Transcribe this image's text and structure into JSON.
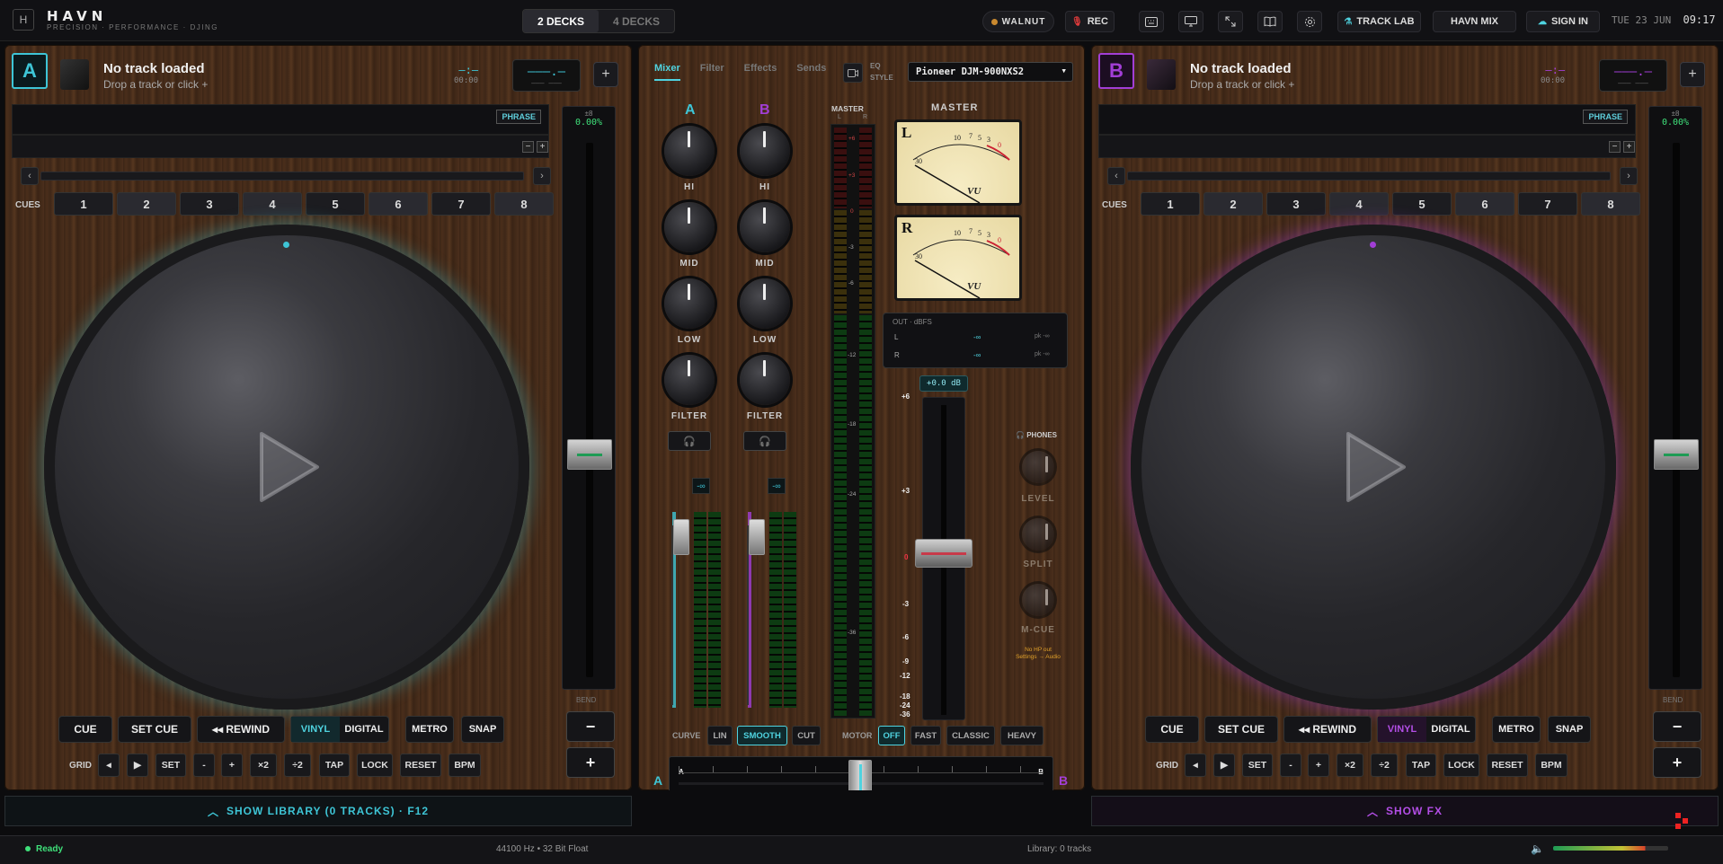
{
  "header": {
    "logo_letter": "H",
    "brand": "HAVN",
    "tagline": "PRECISION · PERFORMANCE · DJING",
    "deck_modes": [
      "2 DECKS",
      "4 DECKS"
    ],
    "theme_label": "WALNUT",
    "rec_label": "REC",
    "track_lab_label": "TRACK LAB",
    "havn_mix_label": "HAVN MIX",
    "sign_in_label": "SIGN IN",
    "date": "TUE 23 JUN",
    "time": "09:17"
  },
  "decks": [
    {
      "letter": "A",
      "color": "#3ec5d6",
      "title": "No track loaded",
      "subtitle": "Drop a track or click +",
      "time_main": "–:–",
      "time_sub": "00:00",
      "bpm_main": "–––.–",
      "bpm_sub": "––– –––",
      "add_label": "+",
      "phrase_label": "PHRASE",
      "cues_label": "CUES",
      "cues": [
        "1",
        "2",
        "3",
        "4",
        "5",
        "6",
        "7",
        "8"
      ],
      "pitch_range": "±8",
      "pitch_value": "0.00%",
      "bend_label": "BEND",
      "bend_minus": "−",
      "bend_plus": "+",
      "transport": [
        "CUE",
        "SET CUE",
        "◂◂ REWIND"
      ],
      "modes": [
        "VINYL",
        "DIGITAL"
      ],
      "active_mode": "VINYL",
      "extras": [
        "METRO",
        "SNAP"
      ],
      "grid_label": "GRID",
      "grid_buttons": [
        "◂",
        "▶",
        "SET",
        "-",
        "+",
        "×2",
        "÷2",
        "TAP",
        "LOCK",
        "RESET",
        "BPM"
      ]
    },
    {
      "letter": "B",
      "color": "#a23ed6",
      "title": "No track loaded",
      "subtitle": "Drop a track or click +",
      "time_main": "–:–",
      "time_sub": "00:00",
      "bpm_main": "–––.–",
      "bpm_sub": "––– –––",
      "add_label": "+",
      "phrase_label": "PHRASE",
      "cues_label": "CUES",
      "cues": [
        "1",
        "2",
        "3",
        "4",
        "5",
        "6",
        "7",
        "8"
      ],
      "pitch_range": "±8",
      "pitch_value": "0.00%",
      "bend_label": "BEND",
      "bend_minus": "−",
      "bend_plus": "+",
      "transport": [
        "CUE",
        "SET CUE",
        "◂◂ REWIND"
      ],
      "modes": [
        "VINYL",
        "DIGITAL"
      ],
      "active_mode": "VINYL",
      "extras": [
        "METRO",
        "SNAP"
      ],
      "grid_label": "GRID",
      "grid_buttons": [
        "◂",
        "▶",
        "SET",
        "-",
        "+",
        "×2",
        "÷2",
        "TAP",
        "LOCK",
        "RESET",
        "BPM"
      ]
    }
  ],
  "mixer": {
    "tabs": [
      "Mixer",
      "Filter",
      "Effects",
      "Sends"
    ],
    "active_tab": "Mixer",
    "eq_style_label": "EQ STYLE",
    "eq_model": "Pioneer DJM-900NXS2",
    "channel_letters": [
      "A",
      "B"
    ],
    "knob_labels": [
      "HI",
      "MID",
      "LOW",
      "FILTER"
    ],
    "master_label": "MASTER",
    "master_lr": [
      "L",
      "R"
    ],
    "master_scale": [
      "+6",
      "+3",
      "0",
      "-3",
      "-6",
      "-12",
      "-18",
      "-24",
      "-36"
    ],
    "vu_letters": [
      "L",
      "R"
    ],
    "vu_scale": [
      "30",
      "10",
      "7",
      "5",
      "3",
      "0"
    ],
    "vu_brand": "VU",
    "out_label": "OUT · dBFS",
    "out_rows": [
      {
        "ch": "L",
        "val": "-∞",
        "pk": "pk -∞"
      },
      {
        "ch": "R",
        "val": "-∞",
        "pk": "pk -∞"
      }
    ],
    "gain_readout": "+0.0 dB",
    "fader_scale": [
      "+6",
      "+3",
      "0",
      "-3",
      "-6",
      "-9",
      "-12",
      "-18",
      "-24",
      "-36"
    ],
    "phones_label": "PHONES",
    "phones_knobs": [
      "LEVEL",
      "SPLIT",
      "M-CUE"
    ],
    "phones_note_1": "No HP out",
    "phones_note_2": "Settings → Audio",
    "curve_label": "CURVE",
    "curve_options": [
      "LIN",
      "SMOOTH",
      "CUT"
    ],
    "curve_active": "SMOOTH",
    "motor_label": "MOTOR",
    "motor_options": [
      "OFF",
      "FAST",
      "CLASSIC",
      "HEAVY"
    ],
    "motor_active": "OFF",
    "xfader_left": "A",
    "xfader_right": "B",
    "channel_peak": "-∞"
  },
  "bottom": {
    "library_label": "SHOW LIBRARY (0 TRACKS) · F12",
    "fx_label": "SHOW FX"
  },
  "status": {
    "state": "Ready",
    "audio_format": "44100 Hz • 32 Bit Float",
    "library": "Library: 0 tracks"
  },
  "colors": {
    "deck_a": "#3ec5d6",
    "deck_b": "#a23ed6",
    "accent": "#4fd3e0",
    "rec": "#e23b3b",
    "ok": "#3fe07a"
  }
}
